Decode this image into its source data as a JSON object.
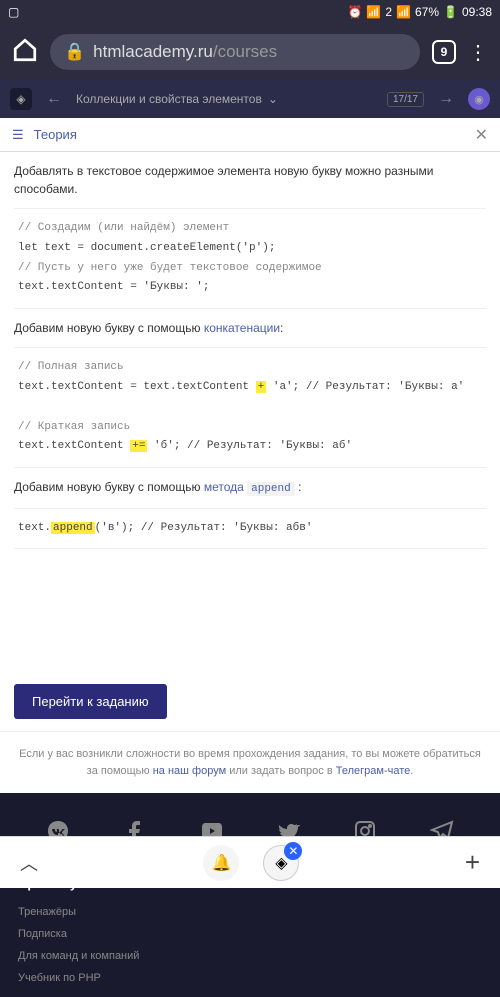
{
  "status": {
    "time": "09:38",
    "battery": "67%",
    "sim": "2"
  },
  "browser": {
    "url_host": "htmlacademy.ru",
    "url_path": "/courses",
    "tabs": "9"
  },
  "nav": {
    "title": "Коллекции и свойства элементов",
    "progress": "17/17"
  },
  "theory": {
    "label": "Теория"
  },
  "content": {
    "intro": "Добавлять в текстовое содержимое элемента новую букву можно разными способами.",
    "code1_c1": "// Создадим (или найдём) элемент",
    "code1_l1": "let text = document.createElement('p');",
    "code1_c2": "// Пусть у него уже будет текстовое содержимое",
    "code1_l2": "text.textContent = 'Буквы: ';",
    "p2_a": "Добавим новую букву с помощью ",
    "p2_link": "конкатенации",
    "p2_b": ":",
    "code2_c1": "// Полная запись",
    "code2_l1a": "text.textContent = text.textContent ",
    "code2_hl1": "+",
    "code2_l1b": " 'а'; // Результат: 'Буквы: а'",
    "code2_c2": "// Краткая запись",
    "code2_l2a": "text.textContent ",
    "code2_hl2": "+=",
    "code2_l2b": " 'б'; // Результат: 'Буквы: аб'",
    "p3_a": "Добавим новую букву с помощью ",
    "p3_link": "метода ",
    "p3_code": "append",
    "p3_b": " :",
    "code3_a": "text.",
    "code3_hl": "append",
    "code3_b": "('в'); // Результат: 'Буквы: абв'"
  },
  "cta": "Перейти к заданию",
  "help": {
    "text1": "Если у вас возникли сложности во время прохождения задания, то вы можете обратиться за помощью ",
    "link1": "на наш форум",
    "text2": " или задать вопрос в ",
    "link2": "Телеграм-чате",
    "text3": "."
  },
  "footer": {
    "heading": "Практикум",
    "links": [
      "Тренажёры",
      "Подписка",
      "Для команд и компаний",
      "Учебник по PHP"
    ]
  }
}
